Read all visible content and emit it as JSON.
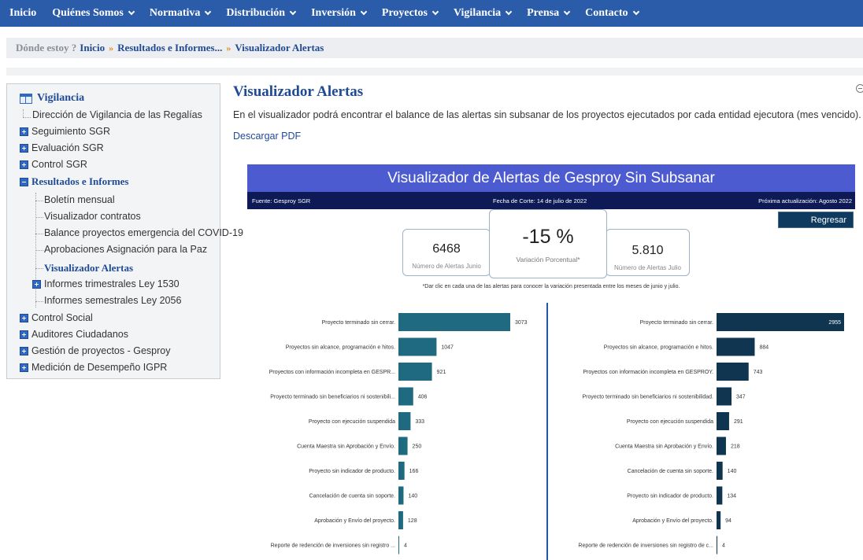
{
  "nav": {
    "items": [
      {
        "label": "Inicio",
        "dropdown": false
      },
      {
        "label": "Quiénes Somos",
        "dropdown": true
      },
      {
        "label": "Normativa",
        "dropdown": true
      },
      {
        "label": "Distribución",
        "dropdown": true
      },
      {
        "label": "Inversión",
        "dropdown": true
      },
      {
        "label": "Proyectos",
        "dropdown": true
      },
      {
        "label": "Vigilancia",
        "dropdown": true
      },
      {
        "label": "Prensa",
        "dropdown": true
      },
      {
        "label": "Contacto",
        "dropdown": true
      }
    ]
  },
  "breadcrumb": {
    "label": "Dónde estoy ?",
    "items": [
      "Inicio",
      "Resultados e Informes...",
      "Visualizador Alertas"
    ],
    "separator": "»"
  },
  "sidebar": {
    "title": "Vigilancia",
    "items": [
      {
        "label": "Dirección de Vigilancia de las Regalías",
        "type": "leaf"
      },
      {
        "label": "Seguimiento SGR",
        "type": "plus"
      },
      {
        "label": "Evaluación SGR",
        "type": "plus"
      },
      {
        "label": "Control SGR",
        "type": "plus"
      },
      {
        "label": "Resultados e Informes",
        "type": "minus"
      },
      {
        "label": "Boletín mensual",
        "type": "child"
      },
      {
        "label": "Visualizador contratos",
        "type": "child"
      },
      {
        "label": "Balance proyectos emergencia del COVID-19",
        "type": "child"
      },
      {
        "label": "Aprobaciones Asignación para la Paz",
        "type": "child"
      },
      {
        "label": "Visualizador Alertas",
        "type": "child-active"
      },
      {
        "label": "Informes trimestrales Ley 1530",
        "type": "child-plus"
      },
      {
        "label": "Informes semestrales Ley 2056",
        "type": "child"
      },
      {
        "label": "Control Social",
        "type": "plus"
      },
      {
        "label": "Auditores Ciudadanos",
        "type": "plus"
      },
      {
        "label": "Gestión de proyectos - Gesproy",
        "type": "plus"
      },
      {
        "label": "Medición de Desempeño IGPR",
        "type": "plus"
      }
    ]
  },
  "main": {
    "title": "Visualizador Alertas",
    "description": "En el visualizador podrá encontrar el balance de las alertas sin subsanar de los proyectos ejecutados por cada entidad ejecutora (mes vencido).",
    "pdf_link": "Descargar PDF"
  },
  "dashboard": {
    "title": "Visualizador de Alertas de Gesproy Sin Subsanar",
    "source": "Fuente: Gesproy SGR",
    "cutoff": "Fecha de Corte: 14 de julio de 2022",
    "next_update": "Próxima actualización: Agosto 2022",
    "back_button": "Regresar",
    "kpi_june": {
      "value": "6468",
      "caption": "Número de Alertas Junio"
    },
    "kpi_change": {
      "value": "-15 %",
      "caption": "Variación Porcentual*"
    },
    "kpi_july": {
      "value": "5.810",
      "caption": "Número de Alertas Julio"
    },
    "note": "*Dar clic en cada una de las alertas para conocer la variación presentada entre los meses de junio y julio.",
    "colors": {
      "header": "#4d5bd1",
      "subbar": "#0d1a56",
      "june_bar": "#1f6a80",
      "july_bar": "#0f3550"
    }
  },
  "chart_data": [
    {
      "type": "bar",
      "orientation": "horizontal",
      "categories": [
        "Proyecto terminado sin cerrar.",
        "Proyectos sin alcance, programación e hitos.",
        "Proyectos con información incompleta en GESPR...",
        "Proyecto terminado sin beneficiarios ni sostenibili...",
        "Proyecto con ejecución suspendida",
        "Cuenta Maestra sin Aprobación y Envío.",
        "Proyecto sin indicador de producto.",
        "Cancelación de cuenta sin soporte.",
        "Aprobación y Envío del proyecto.",
        "Reporte de redención de inversiones sin registro ..."
      ],
      "values": [
        3073,
        1047,
        921,
        406,
        333,
        250,
        166,
        140,
        128,
        4
      ],
      "color": "#1f6a80"
    },
    {
      "type": "bar",
      "orientation": "horizontal",
      "categories": [
        "Proyecto terminado sin cerrar.",
        "Proyectos sin alcance, programación e hitos.",
        "Proyectos con información incompleta en GESPROY.",
        "Proyecto terminado sin beneficiarios ni sostenibilidad.",
        "Proyecto con ejecución suspendida",
        "Cuenta Maestra sin Aprobación y Envío.",
        "Cancelación de cuenta sin soporte.",
        "Proyecto sin indicador de producto.",
        "Aprobación y Envío del proyecto.",
        "Reporte de redención de inversiones sin registro de c..."
      ],
      "values": [
        2955,
        884,
        743,
        347,
        291,
        218,
        140,
        134,
        94,
        4
      ],
      "color": "#0f3550"
    }
  ]
}
